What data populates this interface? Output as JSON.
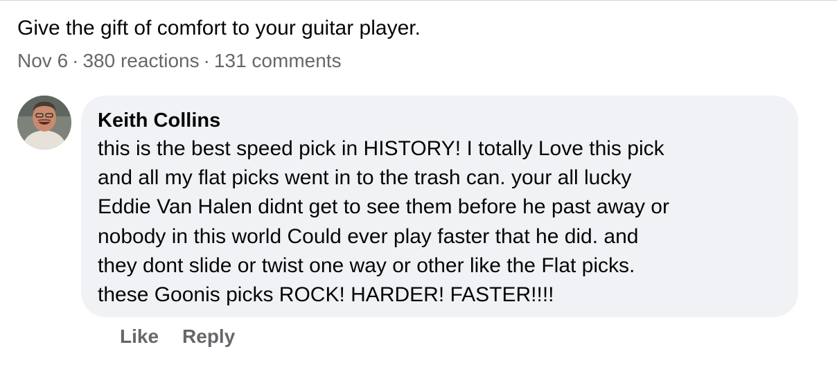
{
  "post": {
    "text": "Give the gift of comfort to your guitar player.",
    "date": "Nov 6",
    "separator": "·",
    "reactions": "380 reactions",
    "comments": "131 comments"
  },
  "comment": {
    "author": "Keith Collins",
    "lines": [
      "this is the best speed pick in HISTORY! I totally Love this pick",
      "and all my flat picks went in to the trash can. your all lucky",
      "Eddie Van Halen didnt get to see them before he past away or",
      "nobody in this world Could ever play faster that he did. and",
      "they dont slide or twist one way or other like the Flat picks.",
      "these Goonis picks ROCK! HARDER! FASTER!!!!"
    ],
    "actions": {
      "like_label": "Like",
      "reply_label": "Reply"
    }
  },
  "colors": {
    "text": "#050505",
    "secondary_text": "#65676b",
    "bubble_bg": "#f0f2f5"
  }
}
